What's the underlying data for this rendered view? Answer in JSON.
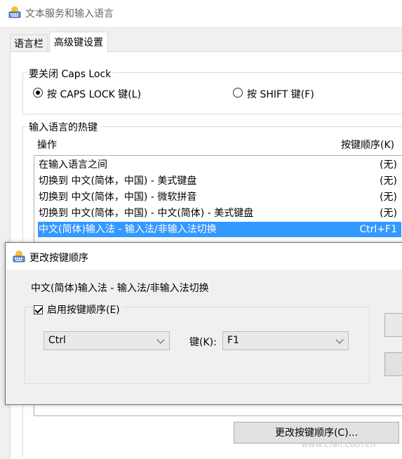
{
  "window": {
    "title": "文本服务和输入语言",
    "icon": "keyboard-globe-icon",
    "tabs": [
      "语言栏",
      "高级键设置"
    ],
    "active_tab": "高级键设置"
  },
  "caps_lock": {
    "group_title": "要关闭 Caps Lock",
    "options": [
      {
        "label": "按 CAPS LOCK 键(L)",
        "selected": true
      },
      {
        "label": "按 SHIFT 键(F)",
        "selected": false
      }
    ]
  },
  "hotkeys": {
    "group_title": "输入语言的热键",
    "col_action": "操作",
    "col_sequence": "按键顺序(K)",
    "rows": [
      {
        "action": "在输入语言之间",
        "sequence": "(无)",
        "selected": false
      },
      {
        "action": "切换到 中文(简体，中国) - 美式键盘",
        "sequence": "(无)",
        "selected": false
      },
      {
        "action": "切换到 中文(简体，中国) - 微软拼音",
        "sequence": "(无)",
        "selected": false
      },
      {
        "action": "切换到 中文(简体，中国) - 中文(简体) - 美式键盘",
        "sequence": "(无)",
        "selected": false
      },
      {
        "action": "中文(简体)输入法 - 输入法/非输入法切换",
        "sequence": "Ctrl+F1",
        "selected": true
      }
    ],
    "change_button": "更改按键顺序(C)..."
  },
  "dialog": {
    "title": "更改按键顺序",
    "description": "中文(简体)输入法 - 输入法/非输入法切换",
    "enable_label": "启用按键顺序(E)",
    "enable_checked": true,
    "modifier_value": "Ctrl",
    "key_label": "键(K):",
    "key_value": "F1"
  },
  "watermark": "www.cfan.com.cn",
  "colors": {
    "selection": "#3399ff"
  }
}
